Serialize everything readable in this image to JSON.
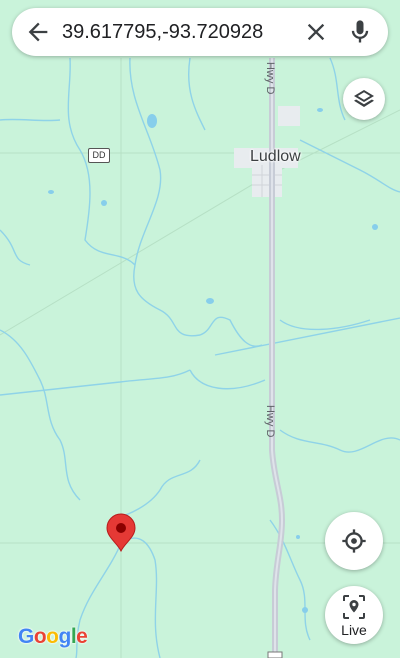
{
  "search": {
    "value": "39.617795,-93.720928"
  },
  "map": {
    "town_label": "Ludlow",
    "road_label_1": "Hwy D",
    "road_label_2": "Hwy D",
    "route_shield": "DD",
    "colors": {
      "land": "#c9f3da",
      "water": "#87ceeb",
      "road": "#c7ccd6",
      "pin": "#e53935"
    }
  },
  "controls": {
    "live_label": "Live"
  },
  "branding": {
    "logo_letters": [
      "G",
      "o",
      "o",
      "g",
      "l",
      "e"
    ],
    "logo_colors": [
      "#4285F4",
      "#EA4335",
      "#FBBC05",
      "#4285F4",
      "#34A853",
      "#EA4335"
    ]
  }
}
